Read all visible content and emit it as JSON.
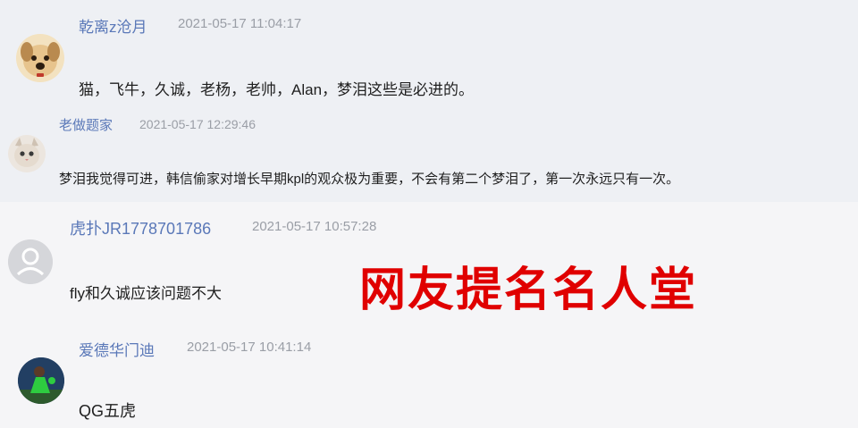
{
  "overlay": {
    "title": "网友提名名人堂"
  },
  "comments": [
    {
      "username": "乾离z沧月",
      "timestamp": "2021-05-17 11:04:17",
      "content": "猫，飞牛，久诚，老杨，老帅，Alan，梦泪这些是必进的。",
      "avatar": "dog-avatar"
    },
    {
      "username": "老做题家",
      "timestamp": "2021-05-17 12:29:46",
      "content": "梦泪我觉得可进，韩信偷家对增长早期kpl的观众极为重要，不会有第二个梦泪了，第一次永远只有一次。",
      "avatar": "cat-avatar"
    },
    {
      "username": "虎扑JR1778701786",
      "timestamp": "2021-05-17 10:57:28",
      "content": "fly和久诚应该问题不大",
      "avatar": "default-user-avatar"
    },
    {
      "username": "爱德华门迪",
      "timestamp": "2021-05-17 10:41:14",
      "content": "QG五虎",
      "avatar": "goalkeeper-avatar"
    }
  ]
}
